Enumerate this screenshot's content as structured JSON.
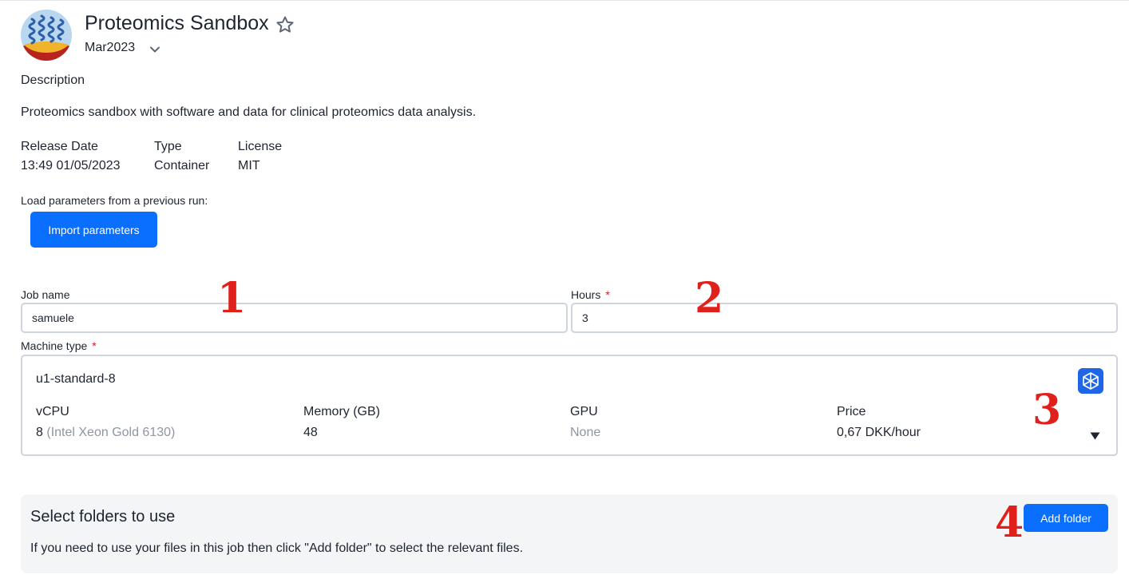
{
  "app": {
    "title": "Proteomics Sandbox",
    "logo_icon": "proteomics-logo",
    "favorite_icon": "star-outline-icon",
    "version": "Mar2023",
    "version_icon": "chevron-down-icon"
  },
  "description": {
    "label": "Description",
    "text": "Proteomics sandbox with software and data for clinical proteomics data analysis."
  },
  "meta": [
    {
      "label": "Release Date",
      "value": "13:49 01/05/2023"
    },
    {
      "label": "Type",
      "value": "Container"
    },
    {
      "label": "License",
      "value": "MIT"
    }
  ],
  "import": {
    "label": "Load parameters from a previous run:",
    "button": "Import parameters"
  },
  "job_name": {
    "label": "Job name",
    "value": "samuele"
  },
  "hours": {
    "label": "Hours",
    "required": "*",
    "value": "3"
  },
  "machine": {
    "label": "Machine type",
    "required": "*",
    "name": "u1-standard-8",
    "provider_icon": "provider-logo-icon",
    "dropdown_icon": "triangle-down-icon",
    "specs": {
      "vcpu_label": "vCPU",
      "vcpu_value": "8",
      "vcpu_detail": "(Intel Xeon Gold 6130)",
      "memory_label": "Memory (GB)",
      "memory_value": "48",
      "gpu_label": "GPU",
      "gpu_value": "None",
      "price_label": "Price",
      "price_value": "0,67 DKK/hour"
    }
  },
  "folders": {
    "title": "Select folders to use",
    "hint": "If you need to use your files in this job then click \"Add folder\" to select the relevant files.",
    "button": "Add folder"
  },
  "annotations": [
    "1",
    "2",
    "3",
    "4"
  ],
  "colors": {
    "primary": "#0a6fff",
    "required": "#d11b1b",
    "annotation": "#e0211b",
    "panel_bg": "#f3f5f7"
  }
}
